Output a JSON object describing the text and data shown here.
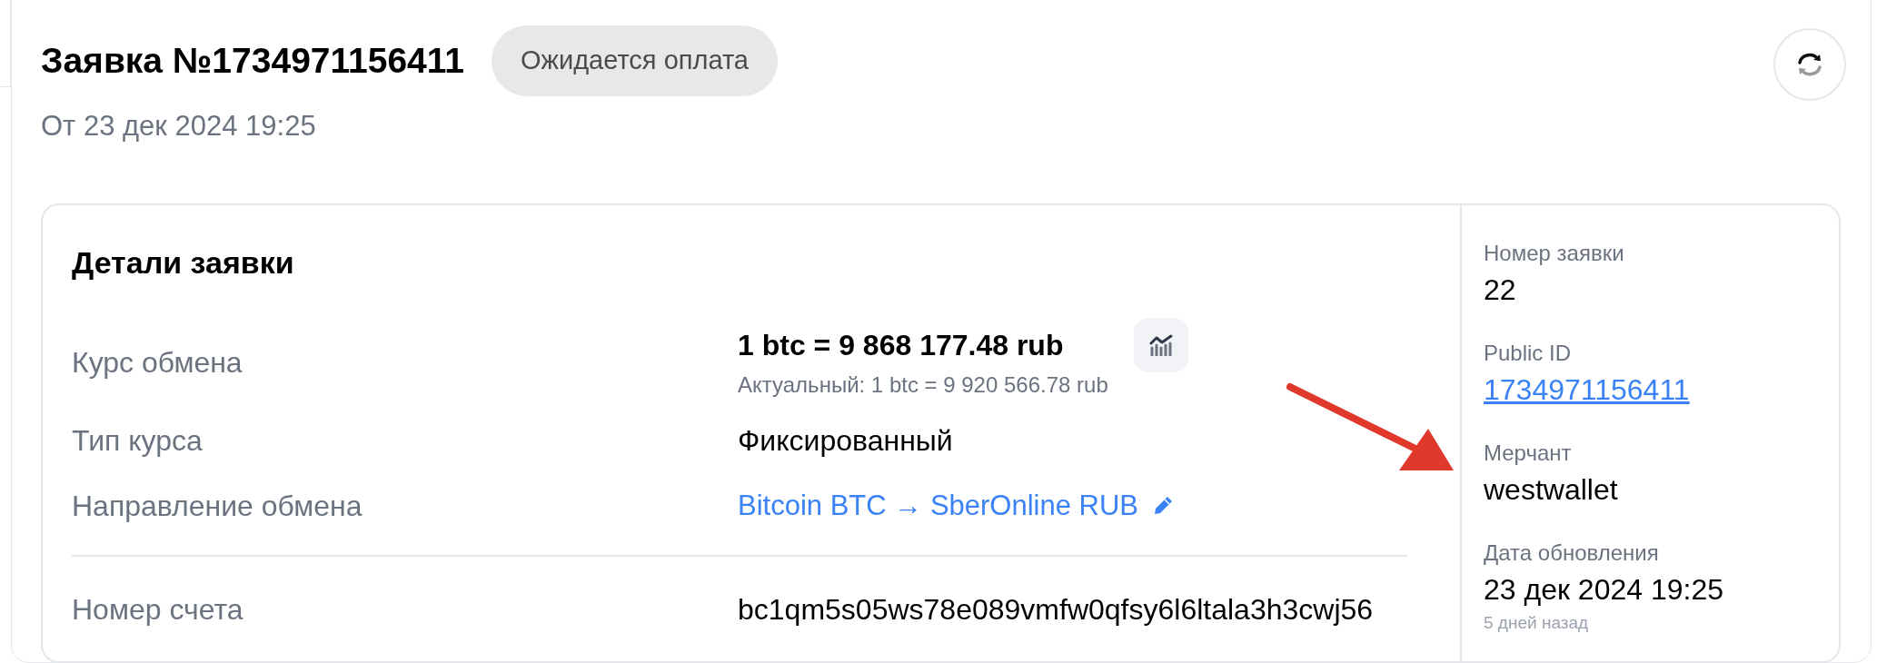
{
  "header": {
    "title": "Заявка №1734971156411",
    "status_badge": "Ожидается оплата",
    "created": "От 23 дек 2024 19:25"
  },
  "details": {
    "title": "Детали заявки",
    "rows": [
      {
        "kind": "rate",
        "label": "Курс обмена",
        "value": "1 btc = 9 868 177.48 rub",
        "note": "Актуальный: 1 btc = 9 920 566.78 rub"
      },
      {
        "kind": "text",
        "label": "Тип курса",
        "value": "Фиксированный"
      },
      {
        "kind": "link",
        "label": "Направление обмена",
        "value": "Bitcoin BTC → SberOnline RUB"
      },
      {
        "kind": "text",
        "label": "Номер счета",
        "value": "bc1qm5s05ws78e089vmfw0qfsy6l6ltala3h3cwj56",
        "divider_before": true
      }
    ]
  },
  "sidebar": {
    "fields": [
      {
        "kind": "text",
        "label": "Номер заявки",
        "value": "22"
      },
      {
        "kind": "link",
        "label": "Public ID",
        "value": "1734971156411"
      },
      {
        "kind": "text",
        "label": "Мерчант",
        "value": "westwallet"
      },
      {
        "kind": "text",
        "label": "Дата обновления",
        "value": "23 дек 2024 19:25",
        "note": "5 дней назад"
      }
    ]
  }
}
